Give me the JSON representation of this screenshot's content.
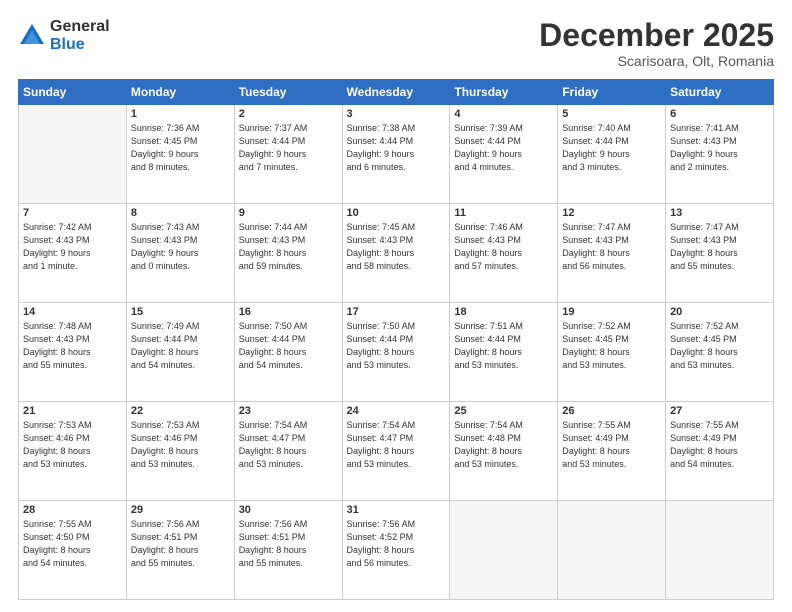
{
  "logo": {
    "general": "General",
    "blue": "Blue"
  },
  "title": "December 2025",
  "subtitle": "Scarisoara, Olt, Romania",
  "days_header": [
    "Sunday",
    "Monday",
    "Tuesday",
    "Wednesday",
    "Thursday",
    "Friday",
    "Saturday"
  ],
  "weeks": [
    [
      {
        "day": "",
        "info": ""
      },
      {
        "day": "1",
        "info": "Sunrise: 7:36 AM\nSunset: 4:45 PM\nDaylight: 9 hours\nand 8 minutes."
      },
      {
        "day": "2",
        "info": "Sunrise: 7:37 AM\nSunset: 4:44 PM\nDaylight: 9 hours\nand 7 minutes."
      },
      {
        "day": "3",
        "info": "Sunrise: 7:38 AM\nSunset: 4:44 PM\nDaylight: 9 hours\nand 6 minutes."
      },
      {
        "day": "4",
        "info": "Sunrise: 7:39 AM\nSunset: 4:44 PM\nDaylight: 9 hours\nand 4 minutes."
      },
      {
        "day": "5",
        "info": "Sunrise: 7:40 AM\nSunset: 4:44 PM\nDaylight: 9 hours\nand 3 minutes."
      },
      {
        "day": "6",
        "info": "Sunrise: 7:41 AM\nSunset: 4:43 PM\nDaylight: 9 hours\nand 2 minutes."
      }
    ],
    [
      {
        "day": "7",
        "info": "Sunrise: 7:42 AM\nSunset: 4:43 PM\nDaylight: 9 hours\nand 1 minute."
      },
      {
        "day": "8",
        "info": "Sunrise: 7:43 AM\nSunset: 4:43 PM\nDaylight: 9 hours\nand 0 minutes."
      },
      {
        "day": "9",
        "info": "Sunrise: 7:44 AM\nSunset: 4:43 PM\nDaylight: 8 hours\nand 59 minutes."
      },
      {
        "day": "10",
        "info": "Sunrise: 7:45 AM\nSunset: 4:43 PM\nDaylight: 8 hours\nand 58 minutes."
      },
      {
        "day": "11",
        "info": "Sunrise: 7:46 AM\nSunset: 4:43 PM\nDaylight: 8 hours\nand 57 minutes."
      },
      {
        "day": "12",
        "info": "Sunrise: 7:47 AM\nSunset: 4:43 PM\nDaylight: 8 hours\nand 56 minutes."
      },
      {
        "day": "13",
        "info": "Sunrise: 7:47 AM\nSunset: 4:43 PM\nDaylight: 8 hours\nand 55 minutes."
      }
    ],
    [
      {
        "day": "14",
        "info": "Sunrise: 7:48 AM\nSunset: 4:43 PM\nDaylight: 8 hours\nand 55 minutes."
      },
      {
        "day": "15",
        "info": "Sunrise: 7:49 AM\nSunset: 4:44 PM\nDaylight: 8 hours\nand 54 minutes."
      },
      {
        "day": "16",
        "info": "Sunrise: 7:50 AM\nSunset: 4:44 PM\nDaylight: 8 hours\nand 54 minutes."
      },
      {
        "day": "17",
        "info": "Sunrise: 7:50 AM\nSunset: 4:44 PM\nDaylight: 8 hours\nand 53 minutes."
      },
      {
        "day": "18",
        "info": "Sunrise: 7:51 AM\nSunset: 4:44 PM\nDaylight: 8 hours\nand 53 minutes."
      },
      {
        "day": "19",
        "info": "Sunrise: 7:52 AM\nSunset: 4:45 PM\nDaylight: 8 hours\nand 53 minutes."
      },
      {
        "day": "20",
        "info": "Sunrise: 7:52 AM\nSunset: 4:45 PM\nDaylight: 8 hours\nand 53 minutes."
      }
    ],
    [
      {
        "day": "21",
        "info": "Sunrise: 7:53 AM\nSunset: 4:46 PM\nDaylight: 8 hours\nand 53 minutes."
      },
      {
        "day": "22",
        "info": "Sunrise: 7:53 AM\nSunset: 4:46 PM\nDaylight: 8 hours\nand 53 minutes."
      },
      {
        "day": "23",
        "info": "Sunrise: 7:54 AM\nSunset: 4:47 PM\nDaylight: 8 hours\nand 53 minutes."
      },
      {
        "day": "24",
        "info": "Sunrise: 7:54 AM\nSunset: 4:47 PM\nDaylight: 8 hours\nand 53 minutes."
      },
      {
        "day": "25",
        "info": "Sunrise: 7:54 AM\nSunset: 4:48 PM\nDaylight: 8 hours\nand 53 minutes."
      },
      {
        "day": "26",
        "info": "Sunrise: 7:55 AM\nSunset: 4:49 PM\nDaylight: 8 hours\nand 53 minutes."
      },
      {
        "day": "27",
        "info": "Sunrise: 7:55 AM\nSunset: 4:49 PM\nDaylight: 8 hours\nand 54 minutes."
      }
    ],
    [
      {
        "day": "28",
        "info": "Sunrise: 7:55 AM\nSunset: 4:50 PM\nDaylight: 8 hours\nand 54 minutes."
      },
      {
        "day": "29",
        "info": "Sunrise: 7:56 AM\nSunset: 4:51 PM\nDaylight: 8 hours\nand 55 minutes."
      },
      {
        "day": "30",
        "info": "Sunrise: 7:56 AM\nSunset: 4:51 PM\nDaylight: 8 hours\nand 55 minutes."
      },
      {
        "day": "31",
        "info": "Sunrise: 7:56 AM\nSunset: 4:52 PM\nDaylight: 8 hours\nand 56 minutes."
      },
      {
        "day": "",
        "info": ""
      },
      {
        "day": "",
        "info": ""
      },
      {
        "day": "",
        "info": ""
      }
    ]
  ]
}
